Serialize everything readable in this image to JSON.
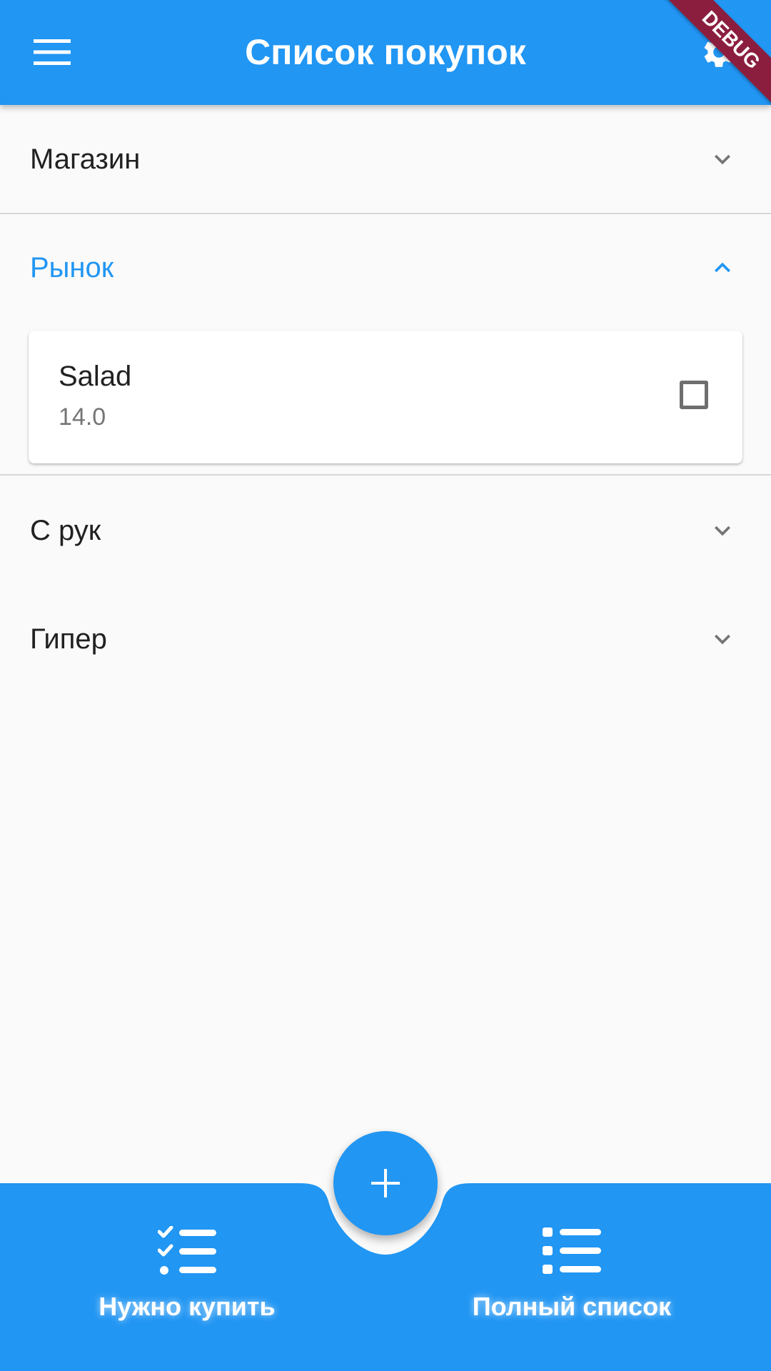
{
  "app_bar": {
    "title": "Список покупок",
    "menu_icon": "menu-icon",
    "settings_icon": "gear-icon",
    "debug_banner": "DEBUG"
  },
  "colors": {
    "primary": "#2196f3",
    "background": "#fafafa",
    "debug_banner": "#8b1e3f"
  },
  "sections": [
    {
      "label": "Магазин",
      "expanded": false
    },
    {
      "label": "Рынок",
      "expanded": true,
      "items": [
        {
          "name": "Salad",
          "value": "14.0",
          "checked": false
        }
      ]
    },
    {
      "label": "С рук",
      "expanded": false
    },
    {
      "label": "Гипер",
      "expanded": false
    }
  ],
  "fab": {
    "icon": "plus-icon"
  },
  "bottom_nav": {
    "items": [
      {
        "label": "Нужно купить",
        "icon": "checklist-icon"
      },
      {
        "label": "Полный список",
        "icon": "list-icon"
      }
    ]
  }
}
